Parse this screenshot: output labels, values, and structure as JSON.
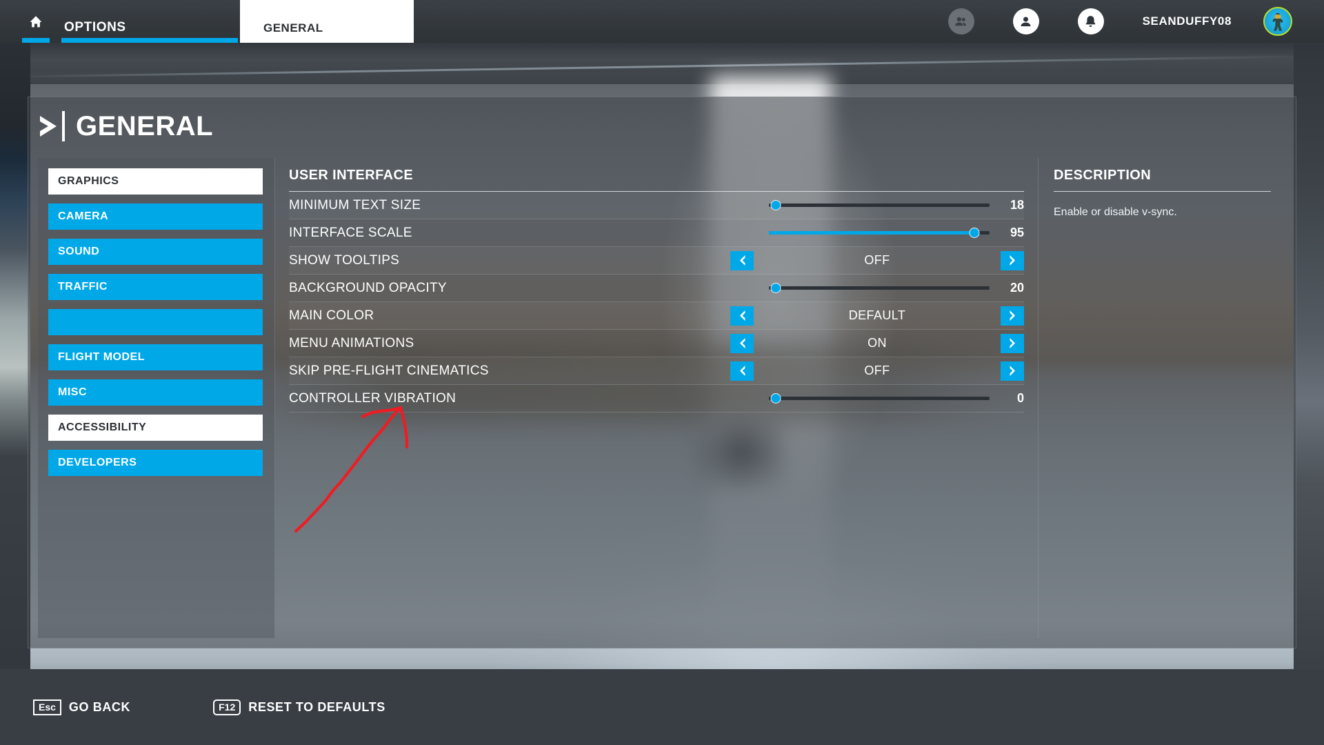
{
  "topbar": {
    "home_icon": "home-icon",
    "options_label": "OPTIONS",
    "active_tab": "GENERAL",
    "icons": [
      {
        "name": "friends-icon",
        "state": "dim"
      },
      {
        "name": "profile-icon",
        "state": "light"
      },
      {
        "name": "notifications-bell-icon",
        "state": "light"
      }
    ],
    "username": "SEANDUFFY08",
    "avatar_name": "user-avatar"
  },
  "page": {
    "title": "GENERAL",
    "chevron_icon": "chevron-right-icon"
  },
  "sidebar": {
    "items": [
      {
        "label": "GRAPHICS",
        "selected": true
      },
      {
        "label": "CAMERA",
        "selected": false
      },
      {
        "label": "SOUND",
        "selected": false
      },
      {
        "label": "TRAFFIC",
        "selected": false
      },
      {
        "label": "",
        "selected": false
      },
      {
        "label": "FLIGHT MODEL",
        "selected": false
      },
      {
        "label": "MISC",
        "selected": false
      },
      {
        "label": "ACCESSIBILITY",
        "selected": true
      },
      {
        "label": "DEVELOPERS",
        "selected": false
      }
    ]
  },
  "settings": {
    "section_title": "USER INTERFACE",
    "rows": [
      {
        "label": "MINIMUM TEXT SIZE",
        "type": "slider",
        "value": "18",
        "percent": 3,
        "filled": false
      },
      {
        "label": "INTERFACE SCALE",
        "type": "slider",
        "value": "95",
        "percent": 93,
        "filled": true
      },
      {
        "label": "SHOW TOOLTIPS",
        "type": "selector",
        "value": "OFF"
      },
      {
        "label": "BACKGROUND OPACITY",
        "type": "slider",
        "value": "20",
        "percent": 3,
        "filled": false
      },
      {
        "label": "MAIN COLOR",
        "type": "selector",
        "value": "DEFAULT"
      },
      {
        "label": "MENU ANIMATIONS",
        "type": "selector",
        "value": "ON"
      },
      {
        "label": "SKIP PRE-FLIGHT CINEMATICS",
        "type": "selector",
        "value": "OFF"
      },
      {
        "label": "CONTROLLER VIBRATION",
        "type": "slider",
        "value": "0",
        "percent": 3,
        "filled": false
      }
    ],
    "prev_arrow_icon": "chevron-left-icon",
    "next_arrow_icon": "chevron-right-icon"
  },
  "description": {
    "title": "DESCRIPTION",
    "body": "Enable or disable v-sync."
  },
  "footer": {
    "actions": [
      {
        "key": "Esc",
        "label": "GO BACK",
        "rounded": false
      },
      {
        "key": "F12",
        "label": "RESET TO DEFAULTS",
        "rounded": true
      }
    ]
  },
  "annotation": {
    "name": "red-arrow-annotation",
    "points_to": "CONTROLLER VIBRATION",
    "color": "#ee1c23"
  },
  "colors": {
    "accent": "#00a8e8",
    "selected_bg": "#ffffff",
    "panel_text": "#ffffff",
    "annotation_red": "#ee1c23"
  }
}
